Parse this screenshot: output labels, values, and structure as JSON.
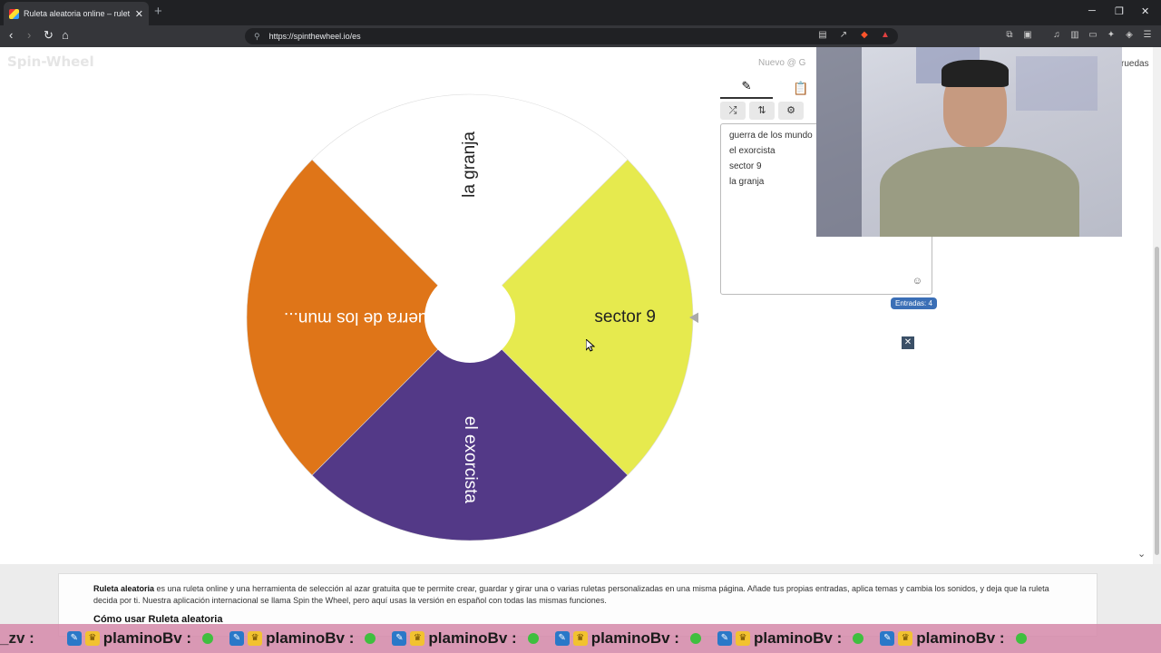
{
  "browser": {
    "tab_title": "Ruleta aleatoria online – rulet",
    "tab_close": "✕",
    "new_tab": "+",
    "url": "https://spinthewheel.io/es"
  },
  "site": {
    "logo": "Spin-Wheel",
    "top_menu": "Nuevo   @ G",
    "top_right": "ruedas"
  },
  "wheel": {
    "segments": [
      {
        "label": "la granja",
        "color": "#ffffff"
      },
      {
        "label": "sector 9",
        "color": "#e6ea4e"
      },
      {
        "label": "el exorcista",
        "color": "#533987"
      },
      {
        "label": "guerra de los mun...",
        "color": "#df7518"
      }
    ]
  },
  "panel": {
    "entries": [
      "guerra de los mundo",
      "el exorcista",
      "sector 9",
      "la granja"
    ],
    "count_label": "Entradas: 4"
  },
  "description": {
    "lead_bold": "Ruleta aleatoria",
    "lead_rest": " es una ruleta online y una herramienta de selección al azar gratuita que te permite crear, guardar y girar una o varias ruletas personalizadas en una misma página. Añade tus propias entradas, aplica temas y cambia los sonidos, y deja que la ruleta decida por ti. Nuestra aplicación internacional se llama Spin the Wheel, pero aquí usas la versión en español con todas las mismas funciones.",
    "heading": "Cómo usar Ruleta aleatoria"
  },
  "ticker": {
    "start": "_zv :",
    "name": "plaminoBv :",
    "repeat": 6
  },
  "colors": {
    "accent": "#3b6fb6",
    "ticker_bg": "#d68cac"
  }
}
